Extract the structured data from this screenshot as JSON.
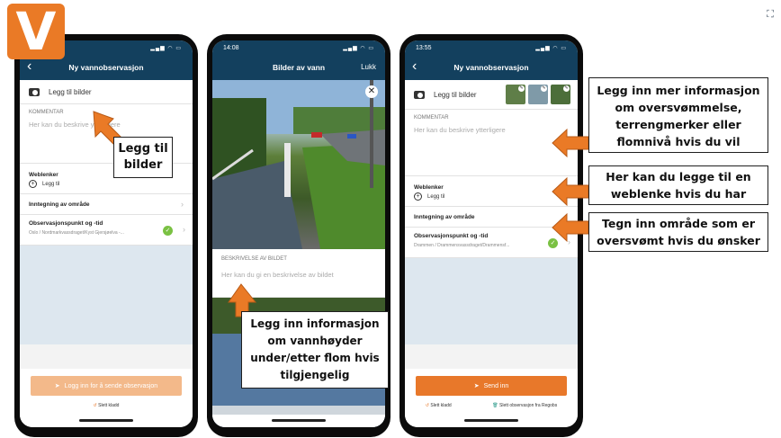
{
  "brand": {
    "letter": "V",
    "color": "#ea7a26"
  },
  "colors": {
    "nav": "#13405e",
    "accent": "#e8782a",
    "check": "#7ac143"
  },
  "phone1": {
    "time": "",
    "title": "Ny vannobservasjon",
    "add_photo": "Legg til bilder",
    "comment_label": "KOMMENTAR",
    "comment_placeholder": "Her kan du beskrive ytterligere",
    "weblinks_label": "Weblenker",
    "add_link": "Legg til",
    "area_label": "Inntegning av område",
    "obs_title": "Observasjonspunkt og -tid",
    "obs_sub": "Oslo / Nordmarkvassdraget/Kyst Gjersjøelva -...",
    "send_label": "Logg inn for å sende observasjon",
    "delete_draft": "Slett kladd"
  },
  "phone2": {
    "time": "14:08",
    "title": "Bilder av vann",
    "close": "Lukk",
    "desc_label": "BESKRIVELSE AV BILDET",
    "desc_placeholder": "Her kan du gi en beskrivelse av bildet"
  },
  "phone3": {
    "time": "13:55",
    "title": "Ny vannobservasjon",
    "add_photo": "Legg til bilder",
    "comment_label": "KOMMENTAR",
    "comment_placeholder": "Her kan du beskrive ytterligere",
    "weblinks_label": "Weblenker",
    "add_link": "Legg til",
    "area_label": "Inntegning av område",
    "obs_title": "Observasjonspunkt og -tid",
    "obs_sub": "Drammen / Drammensvassdraget/Drammensf...",
    "send_label": "Send inn",
    "delete_draft": "Slett kladd",
    "delete_obs": "Slett observasjon fra Regobs"
  },
  "callouts": {
    "add_photos": "Legg til bilder",
    "water_info": "Legg inn informasjon om vannhøyder under/etter flom hvis tilgjengelig",
    "more_info": "Legg inn mer informasjon om oversvømmelse, terrengmerker eller flomnivå hvis du vil",
    "weblink": "Her kan du legge til en weblenke hvis du har",
    "area": "Tegn inn område som er oversvømt hvis du ønsker"
  }
}
